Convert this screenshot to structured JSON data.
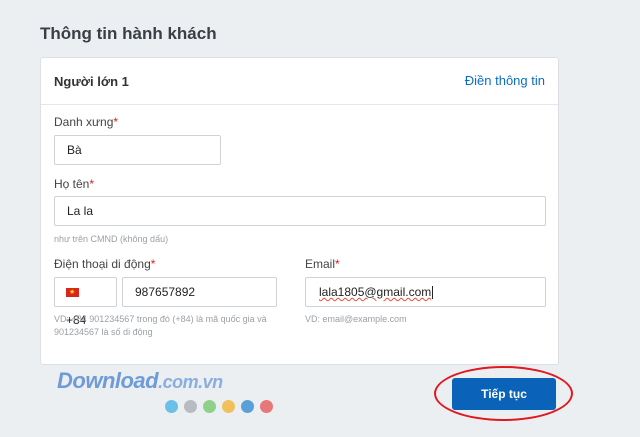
{
  "section_title": "Thông tin hành khách",
  "card": {
    "title": "Người lớn 1",
    "fill_link": "Điền thông tin"
  },
  "form": {
    "salutation": {
      "label": "Danh xưng",
      "required_mark": "*",
      "value": "Bà"
    },
    "full_name": {
      "label": "Họ tên",
      "required_mark": "*",
      "value": "La la",
      "hint": "như trên CMND (không dấu)"
    },
    "phone": {
      "label": "Điện thoại di động",
      "required_mark": "*",
      "country_code": "+84",
      "value": "987657892",
      "hint_line1": "VD: +84 901234567 trong đó (+84) là mã quốc gia và",
      "hint_line2": "901234567 là số di động"
    },
    "email": {
      "label": "Email",
      "required_mark": "*",
      "value": "lala1805@gmail.com",
      "hint": "VD: email@example.com"
    }
  },
  "continue_button": "Tiếp tục",
  "watermark": {
    "main": "Download",
    "suffix": ".com.vn"
  },
  "colors": {
    "primary": "#0a63b8",
    "link": "#0b6ec2",
    "required": "#e01a1a",
    "highlight_circle": "#e01820",
    "dots": [
      "#6cc0e8",
      "#b8bcc2",
      "#8fd08a",
      "#f0c05a",
      "#5aa0d8",
      "#e87878"
    ]
  }
}
